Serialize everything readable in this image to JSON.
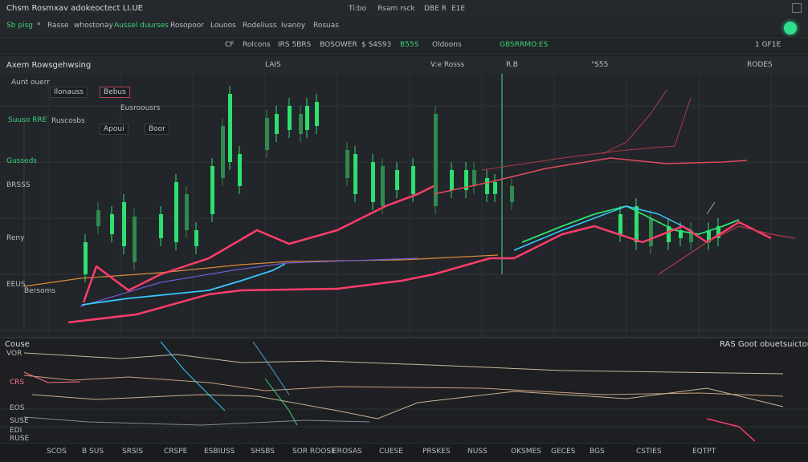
{
  "titlebar": {
    "title": "Chsm Rosmxav adokeoctect LI.UE",
    "center_items": [
      "Ti:bo",
      "Rsam rsck",
      "DBE R",
      "E1E"
    ]
  },
  "tabs": [
    "Sb pisg",
    "*",
    "Rasse",
    "whostonay",
    "Aussel duurses",
    "Rosopoor",
    "Louoos",
    "Rodeliuss",
    "Ivanoy",
    "Rosuas"
  ],
  "toolbar": {
    "items": [
      "CF",
      "Rolcons",
      "IRS 5BRS",
      "BOSOWER",
      "$ S4S93",
      "B55S",
      "Oldoons",
      "GBSRRMO:ES",
      "1 GF1E"
    ]
  },
  "header": {
    "items": [
      "Axem Rowsgehwsing",
      "LAIS",
      "V:e Rosss",
      "R.B",
      "\"S55",
      "RODES"
    ]
  },
  "main_overlay": {
    "legend_top": [
      "Ilonauss",
      "Bebus",
      "Eusroousrs",
      "Ruscosbs"
    ],
    "left_labels": [
      "Aunt ouerr",
      "Suuso RRE",
      "Gusseds",
      "BRSSS",
      "Reny",
      "EEUS",
      "Bersoms"
    ],
    "buttons": [
      "Apoui",
      "Boor"
    ]
  },
  "lower": {
    "title_left": "Couse",
    "title_right": "RAS Goot obuetsuictou",
    "left_labels": [
      "VOR",
      "CRS",
      "EOS",
      "SUSE",
      "EDI",
      "RUSE"
    ]
  },
  "statusbar": {
    "items": [
      "SCOS",
      "B SUS",
      "SRSIS",
      "CRSPE",
      "ESBIUSS",
      "SHSBS",
      "SOR ROOSE",
      "EROSAS",
      "CUESE",
      "PRSKES",
      "NUSS",
      "OKSMES",
      "GECES",
      "BGS",
      "CSTIES",
      "EQTPT"
    ]
  },
  "colors": {
    "bull": "#2ee06f",
    "bear": "#2f8a4e",
    "red_line": "#ff3d6a",
    "cyan_line": "#38c7ff",
    "purple_line": "#6d5bd6",
    "orange_line": "#d98a3a",
    "accent": "#2fe08a"
  }
}
